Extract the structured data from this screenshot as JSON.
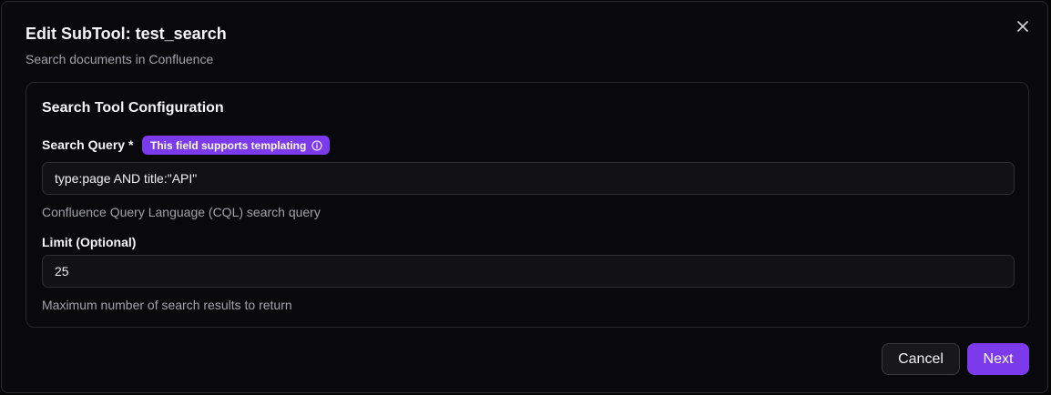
{
  "dialog": {
    "title": "Edit SubTool: test_search",
    "subtitle": "Search documents in Confluence"
  },
  "card": {
    "title": "Search Tool Configuration",
    "query_field": {
      "label": "Search Query *",
      "badge": "This field supports templating",
      "badge_icon": "info-icon",
      "value": "type:page AND title:\"API\"",
      "help": "Confluence Query Language (CQL) search query"
    },
    "limit_field": {
      "label": "Limit (Optional)",
      "value": "25",
      "help": "Maximum number of search results to return"
    }
  },
  "actions": {
    "cancel_label": "Cancel",
    "next_label": "Next"
  },
  "colors": {
    "accent": "#7c3aed",
    "background": "#09090b",
    "muted_text": "#a1a1aa"
  }
}
